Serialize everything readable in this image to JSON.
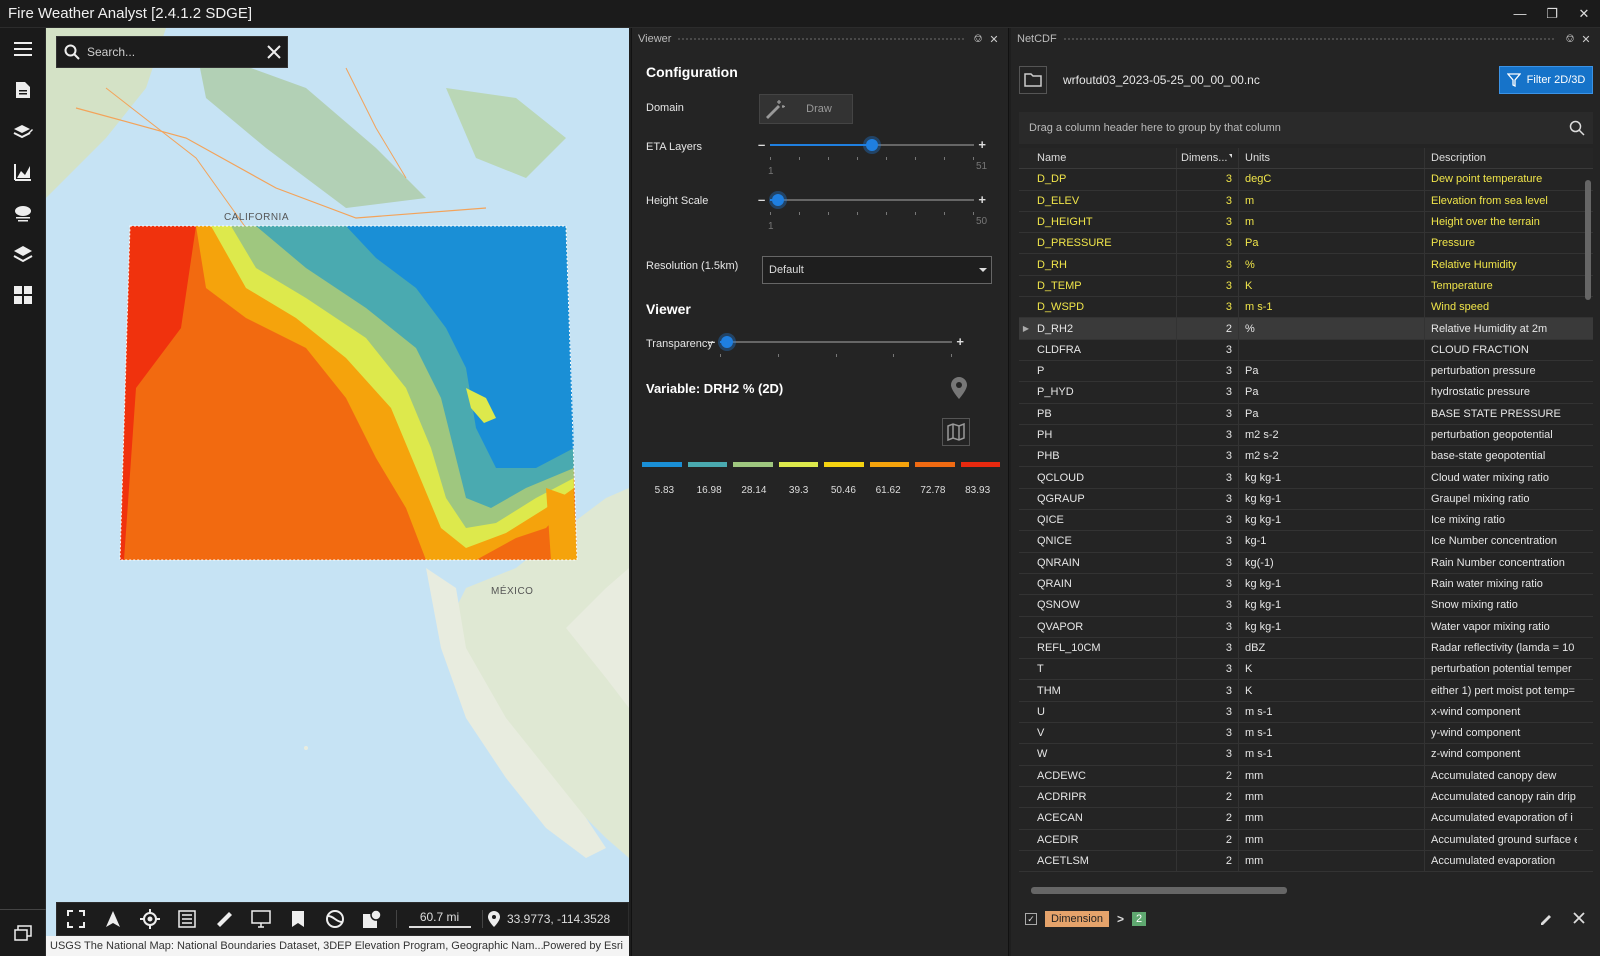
{
  "window": {
    "title": "Fire Weather Analyst [2.4.1.2 SDGE]"
  },
  "rail": {
    "items": [
      "menu-icon",
      "document-icon",
      "layers-edit-icon",
      "chart-icon",
      "weather-icon",
      "layers-icon",
      "grid-icon"
    ]
  },
  "map": {
    "search_placeholder": "Search...",
    "labels": {
      "california": "CALIFORNIA",
      "mexico": "MÉXICO"
    },
    "scale": "60.7 mi",
    "coordinates": "33.9773, -114.3528",
    "attribution": "USGS The National Map: National Boundaries Dataset, 3DEP Elevation Program, Geographic Nam...",
    "powered_by": "Powered by Esri"
  },
  "viewer": {
    "panel_title": "Viewer",
    "configuration_title": "Configuration",
    "domain_label": "Domain",
    "draw_label": "Draw",
    "eta_label": "ETA Layers",
    "eta": {
      "min": "1",
      "max": "51",
      "value_fraction": 0.5
    },
    "height_label": "Height Scale",
    "height": {
      "min": "1",
      "max": "50",
      "value_fraction": 0.04
    },
    "resolution_label": "Resolution (1.5km)",
    "resolution_value": "Default",
    "viewer_title": "Viewer",
    "transparency_label": "Transparency",
    "transparency": {
      "value_fraction": 0.03
    },
    "variable_title": "Variable: DRH2 % (2D)",
    "legend": {
      "colors": [
        "#1a8fd6",
        "#4aaab0",
        "#9fc77f",
        "#dde94c",
        "#f5d311",
        "#f5a30c",
        "#f06a12",
        "#e8290f"
      ],
      "labels": [
        "5.83",
        "16.98",
        "28.14",
        "39.3",
        "50.46",
        "61.62",
        "72.78",
        "83.93"
      ]
    }
  },
  "netcdf": {
    "panel_title": "NetCDF",
    "file_name": "wrfoutd03_2023-05-25_00_00_00.nc",
    "filter_label": "Filter 2D/3D",
    "group_hint": "Drag a column header here to group by that column",
    "columns": [
      "Name",
      "Dimens...",
      "Units",
      "Description"
    ],
    "rows": [
      {
        "name": "D_DP",
        "dim": "3",
        "units": "degC",
        "desc": "Dew point temperature",
        "hl": true
      },
      {
        "name": "D_ELEV",
        "dim": "3",
        "units": "m",
        "desc": "Elevation from sea level",
        "hl": true
      },
      {
        "name": "D_HEIGHT",
        "dim": "3",
        "units": "m",
        "desc": "Height over the terrain",
        "hl": true
      },
      {
        "name": "D_PRESSURE",
        "dim": "3",
        "units": "Pa",
        "desc": "Pressure",
        "hl": true
      },
      {
        "name": "D_RH",
        "dim": "3",
        "units": "%",
        "desc": "Relative Humidity",
        "hl": true
      },
      {
        "name": "D_TEMP",
        "dim": "3",
        "units": "K",
        "desc": "Temperature",
        "hl": true
      },
      {
        "name": "D_WSPD",
        "dim": "3",
        "units": "m s-1",
        "desc": "Wind speed",
        "hl": true
      },
      {
        "name": "D_RH2",
        "dim": "2",
        "units": "%",
        "desc": "Relative Humidity at 2m",
        "sel": true
      },
      {
        "name": "CLDFRA",
        "dim": "3",
        "units": "",
        "desc": "CLOUD FRACTION"
      },
      {
        "name": "P",
        "dim": "3",
        "units": "Pa",
        "desc": "perturbation pressure"
      },
      {
        "name": "P_HYD",
        "dim": "3",
        "units": "Pa",
        "desc": "hydrostatic pressure"
      },
      {
        "name": "PB",
        "dim": "3",
        "units": "Pa",
        "desc": "BASE STATE PRESSURE"
      },
      {
        "name": "PH",
        "dim": "3",
        "units": "m2 s-2",
        "desc": "perturbation geopotential"
      },
      {
        "name": "PHB",
        "dim": "3",
        "units": "m2 s-2",
        "desc": "base-state geopotential"
      },
      {
        "name": "QCLOUD",
        "dim": "3",
        "units": "kg kg-1",
        "desc": "Cloud water mixing ratio"
      },
      {
        "name": "QGRAUP",
        "dim": "3",
        "units": "kg kg-1",
        "desc": "Graupel mixing ratio"
      },
      {
        "name": "QICE",
        "dim": "3",
        "units": "kg kg-1",
        "desc": "Ice mixing ratio"
      },
      {
        "name": "QNICE",
        "dim": "3",
        "units": "  kg-1",
        "desc": "Ice Number concentration"
      },
      {
        "name": "QNRAIN",
        "dim": "3",
        "units": "  kg(-1)",
        "desc": "Rain Number concentration"
      },
      {
        "name": "QRAIN",
        "dim": "3",
        "units": "kg kg-1",
        "desc": "Rain water mixing ratio"
      },
      {
        "name": "QSNOW",
        "dim": "3",
        "units": "kg kg-1",
        "desc": "Snow mixing ratio"
      },
      {
        "name": "QVAPOR",
        "dim": "3",
        "units": "kg kg-1",
        "desc": "Water vapor mixing ratio"
      },
      {
        "name": "REFL_10CM",
        "dim": "3",
        "units": "dBZ",
        "desc": "Radar reflectivity (lamda = 10"
      },
      {
        "name": "T",
        "dim": "3",
        "units": "K",
        "desc": "perturbation potential temper"
      },
      {
        "name": "THM",
        "dim": "3",
        "units": "K",
        "desc": "either 1) pert moist pot temp="
      },
      {
        "name": "U",
        "dim": "3",
        "units": "m s-1",
        "desc": "x-wind component"
      },
      {
        "name": "V",
        "dim": "3",
        "units": "m s-1",
        "desc": "y-wind component"
      },
      {
        "name": "W",
        "dim": "3",
        "units": "m s-1",
        "desc": "z-wind component"
      },
      {
        "name": "ACDEWC",
        "dim": "2",
        "units": "mm",
        "desc": "Accumulated canopy dew"
      },
      {
        "name": "ACDRIPR",
        "dim": "2",
        "units": "mm",
        "desc": "Accumulated canopy rain drip"
      },
      {
        "name": "ACECAN",
        "dim": "2",
        "units": "mm",
        "desc": "Accumulated evaporation of i"
      },
      {
        "name": "ACEDIR",
        "dim": "2",
        "units": "mm",
        "desc": "Accumulated ground surface e"
      },
      {
        "name": "ACETLSM",
        "dim": "2",
        "units": "mm",
        "desc": "Accumulated evaporation"
      }
    ],
    "filter": {
      "field": "Dimension",
      "op": ">",
      "value": "2"
    }
  }
}
